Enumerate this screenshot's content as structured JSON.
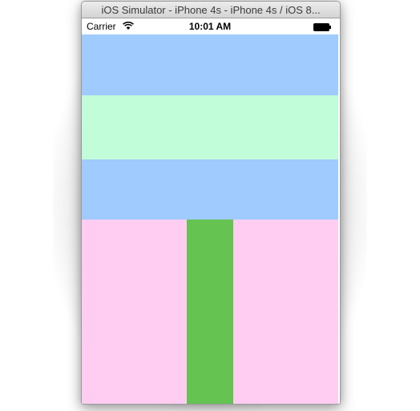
{
  "window": {
    "title": "iOS Simulator - iPhone 4s - iPhone 4s / iOS 8..."
  },
  "status_bar": {
    "carrier": "Carrier",
    "time": "10:01 AM",
    "wifi_icon": "wifi-icon",
    "battery_icon": "battery-icon"
  },
  "colors": {
    "blue": "#9fcbff",
    "mint": "#c2fdd9",
    "pink": "#fecdf1",
    "green": "#64c351"
  }
}
